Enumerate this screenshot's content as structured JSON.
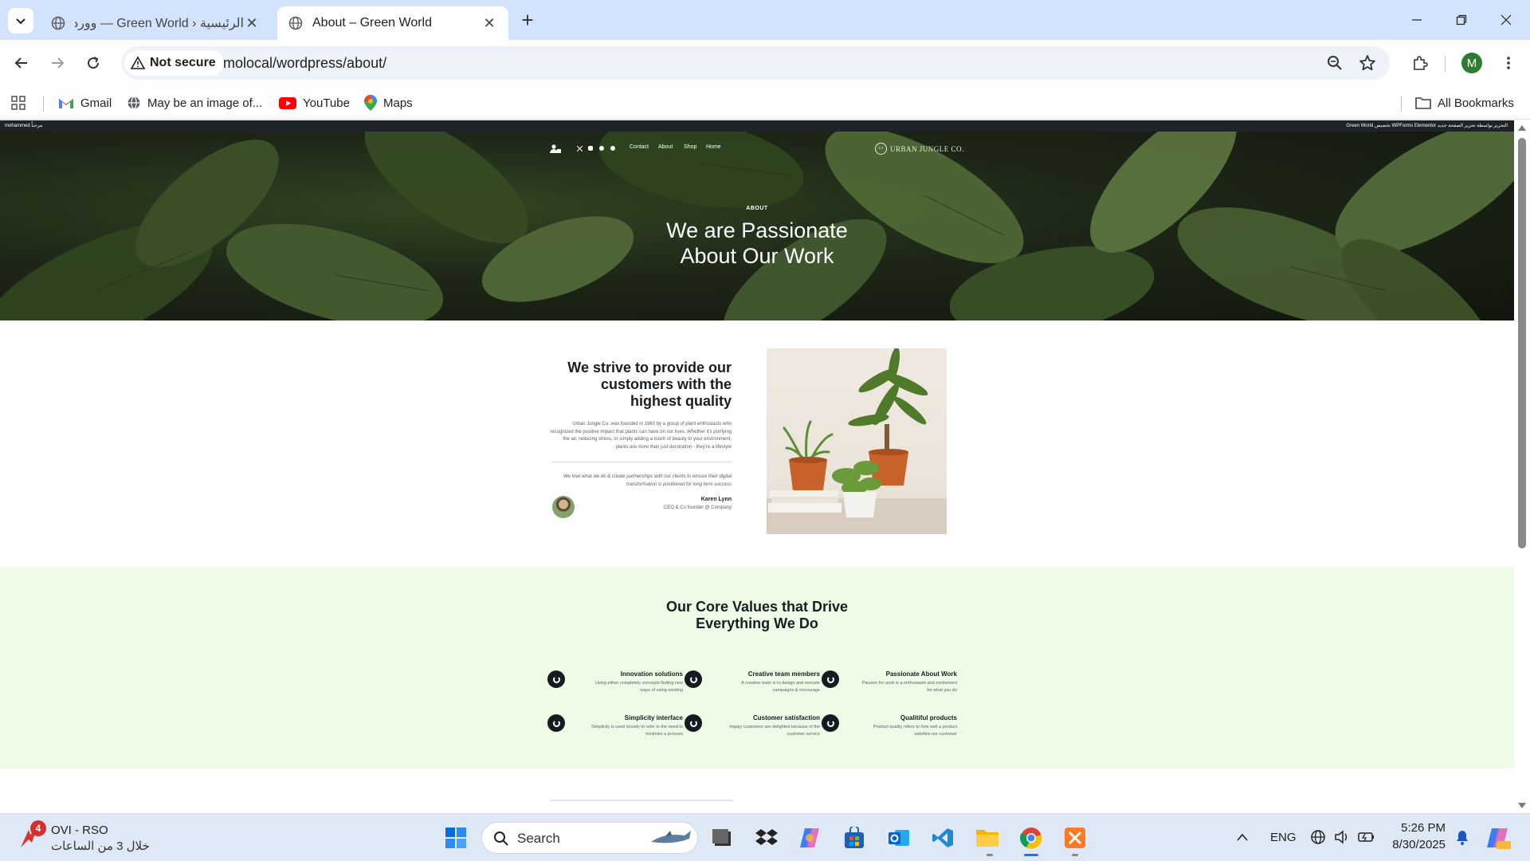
{
  "browser": {
    "tabs": [
      {
        "title": "الرئيسية ‹ Green World — ووردب",
        "active": false
      },
      {
        "title": "About – Green World",
        "active": true
      }
    ],
    "security_label": "Not secure",
    "url": "molocal/wordpress/about/",
    "profile_initial": "M",
    "bookmarks": [
      {
        "label": "Gmail",
        "icon": "gmail-icon"
      },
      {
        "label": "May be an image of...",
        "icon": "globe-icon"
      },
      {
        "label": "YouTube",
        "icon": "youtube-icon"
      },
      {
        "label": "Maps",
        "icon": "maps-icon"
      }
    ],
    "all_bookmarks": "All Bookmarks"
  },
  "adminbar": {
    "left": "mohammed  مرحباً",
    "right": "Green World  تخصيص  WPForms  Elementor  التحرير بواسطة  تحرير الصفحة  جديد"
  },
  "site": {
    "nav": {
      "contact": "Contact",
      "about": "About",
      "shop": "Shop",
      "home": "Home"
    },
    "logo": "URBAN JUNGLE CO.",
    "hero_eyebrow": "ABOUT",
    "hero_title_1": "We are Passionate",
    "hero_title_2": "About Our Work"
  },
  "about": {
    "heading_1": "We strive to provide our",
    "heading_2": "customers with the",
    "heading_3": "highest quality",
    "paragraph": "Urban Jungle Co. was founded in 1960 by a group of plant enthusiasts who recognized the positive impact that plants can have on our lives. Whether it's purifying the air, reducing stress, or simply adding a touch of beauty to your environment, plants are more than just decoration - they're a lifestyle",
    "quote": "We love what we do & create partnerships with our clients to ensure their digital transformation is positioned for long term success",
    "person_name": "Karen Lynn",
    "person_role": "CEO & Co founder @ Company"
  },
  "values": {
    "heading_1": "Our Core Values that Drive",
    "heading_2": "Everything We Do",
    "items": [
      {
        "title": "Innovation solutions",
        "desc": "Using either completely concepts finding new ways of using existing"
      },
      {
        "title": "Creative team members",
        "desc": "A creative team is to design and execute campaigns & encourage"
      },
      {
        "title": "Passionate About Work",
        "desc": "Passion for work is a enthusiasm and excitement for what you do"
      },
      {
        "title": "Simplicity interface",
        "desc": "Simplicity is used loosely to refer to the need to minimize a process"
      },
      {
        "title": "Customer satisfaction",
        "desc": "Happy customers are delighted because of the customer service"
      },
      {
        "title": "Qualitiful products",
        "desc": "Product quality refers to how well a product satisfies our customer"
      }
    ]
  },
  "taskbar": {
    "notif_count": "4",
    "notif_title": "OVI - RSO",
    "notif_sub": "خلال 3 من الساعات",
    "search": "Search",
    "lang": "ENG",
    "time": "5:26 PM",
    "date": "8/30/2025"
  },
  "colors": {
    "tabstrip": "#d3e3fd",
    "values_bg": "#eefbe6",
    "taskbar": "#dfe9f6"
  }
}
